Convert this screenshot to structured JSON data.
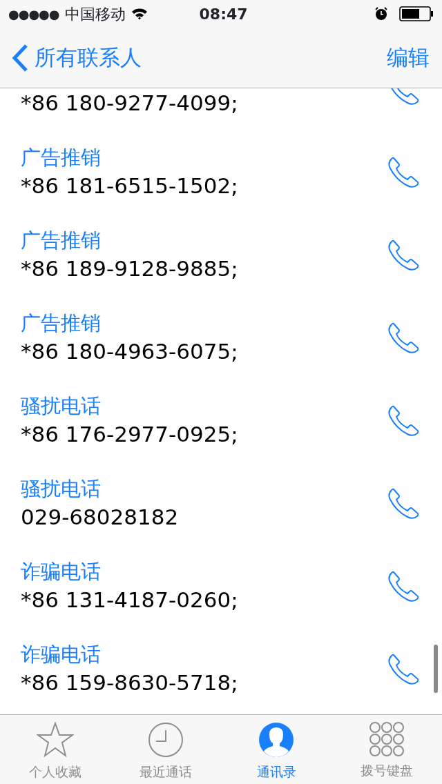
{
  "status_bar": {
    "carrier": "中国移动",
    "time": "08:47",
    "signal_dots": "●●●●●"
  },
  "nav": {
    "back_label": "所有联系人",
    "action": "编辑"
  },
  "entries": [
    {
      "number": "*86 180-9277-4099;"
    },
    {
      "label": "广告推销",
      "number": "*86 181-6515-1502;"
    },
    {
      "label": "广告推销",
      "number": "*86 189-9128-9885;"
    },
    {
      "label": "广告推销",
      "number": "*86 180-4963-6075;"
    },
    {
      "label": "骚扰电话",
      "number": "*86 176-2977-0925;"
    },
    {
      "label": "骚扰电话",
      "number": "029-68028182"
    },
    {
      "label": "诈骗电话",
      "number": "*86 131-4187-0260;"
    },
    {
      "label": "诈骗电话",
      "number": "*86 159-8630-5718;"
    }
  ],
  "tabs": [
    {
      "label": "个人收藏",
      "kind": "star",
      "selected": false
    },
    {
      "label": "最近通话",
      "kind": "clock",
      "selected": false
    },
    {
      "label": "通讯录",
      "kind": "contacts",
      "selected": true
    },
    {
      "label": "拨号键盘",
      "kind": "keypad",
      "selected": false
    }
  ]
}
